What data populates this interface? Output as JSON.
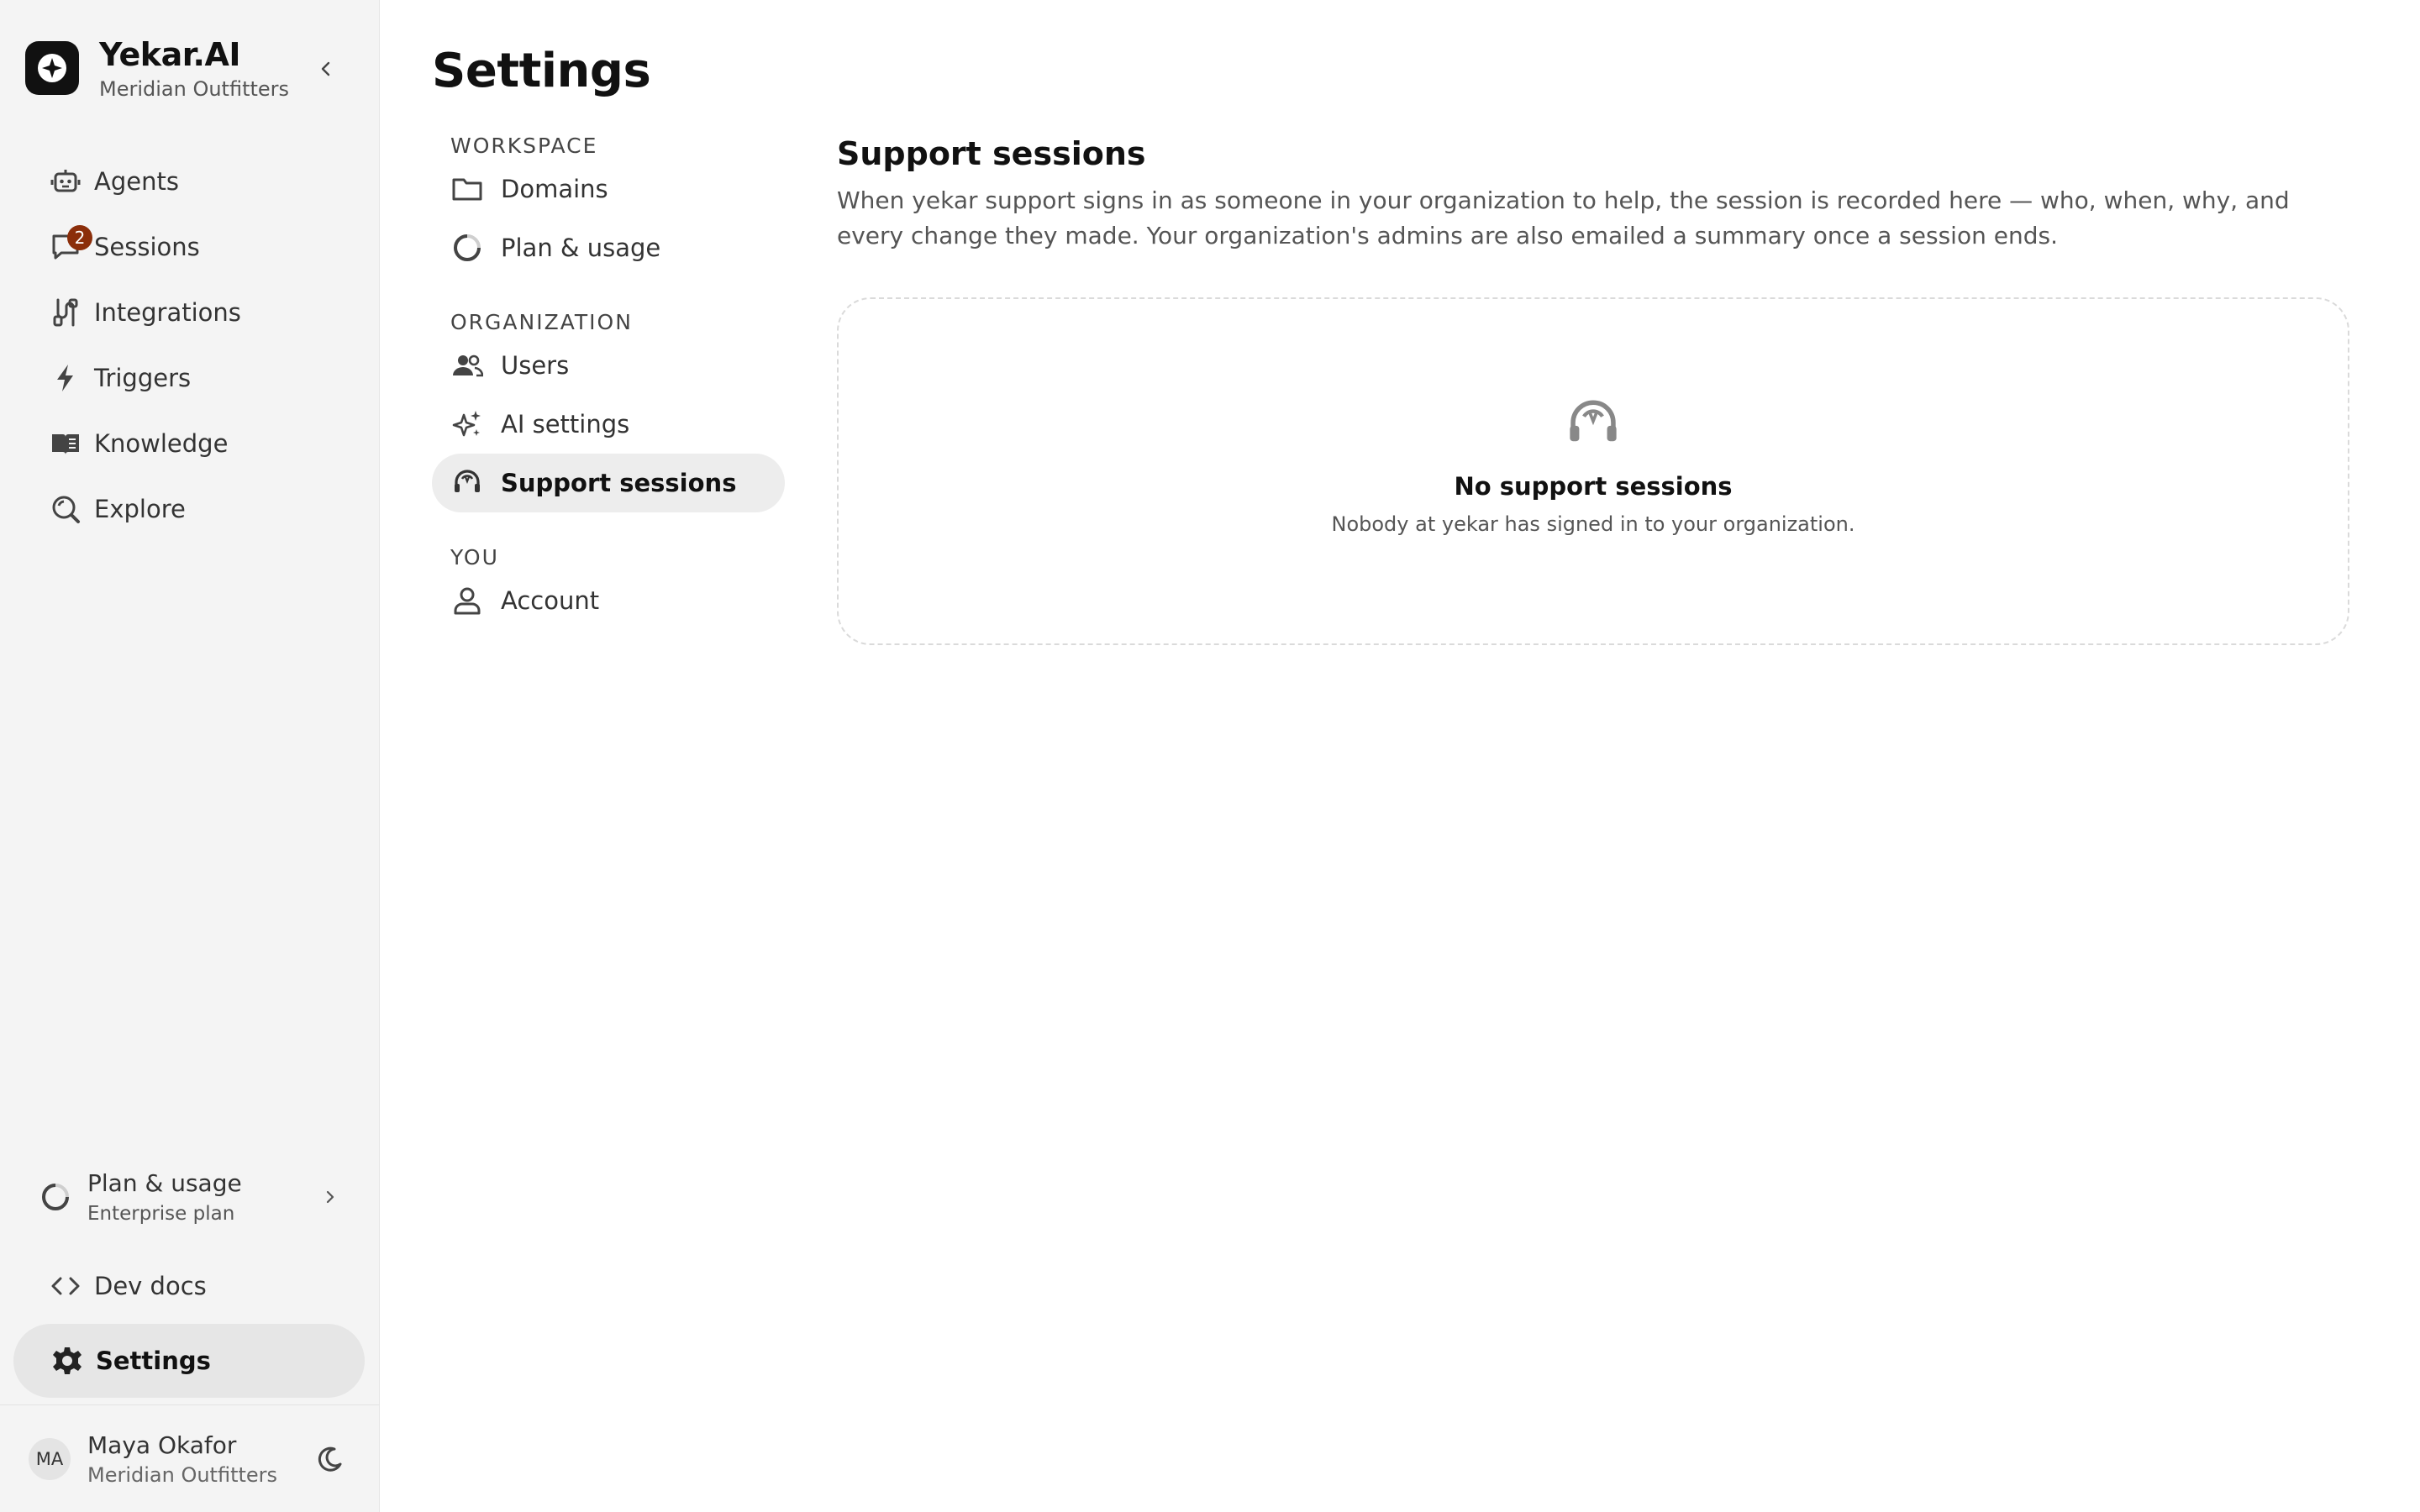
{
  "brand": {
    "name": "Yekar.AI",
    "org": "Meridian Outfitters"
  },
  "sidebar": {
    "items": [
      {
        "label": "Agents",
        "icon": "robot-icon"
      },
      {
        "label": "Sessions",
        "icon": "chat-icon",
        "badge": "2"
      },
      {
        "label": "Integrations",
        "icon": "plug-icon"
      },
      {
        "label": "Triggers",
        "icon": "bolt-icon"
      },
      {
        "label": "Knowledge",
        "icon": "book-icon"
      },
      {
        "label": "Explore",
        "icon": "explore-icon"
      }
    ],
    "plan": {
      "title": "Plan & usage",
      "subtitle": "Enterprise plan"
    },
    "dev_docs": "Dev docs",
    "settings": "Settings",
    "user": {
      "initials": "MA",
      "name": "Maya Okafor",
      "org": "Meridian Outfitters"
    }
  },
  "settings": {
    "title": "Settings",
    "sections": [
      {
        "label": "WORKSPACE",
        "items": [
          "Domains",
          "Plan & usage"
        ]
      },
      {
        "label": "ORGANIZATION",
        "items": [
          "Users",
          "AI settings",
          "Support sessions"
        ]
      },
      {
        "label": "YOU",
        "items": [
          "Account"
        ]
      }
    ],
    "active_item": "Support sessions"
  },
  "content": {
    "title": "Support sessions",
    "description": "When yekar support signs in as someone in your organization to help, the session is recorded here — who, when, why, and every change they made. Your organization's admins are also emailed a summary once a session ends.",
    "empty_title": "No support sessions",
    "empty_subtitle": "Nobody at yekar has signed in to your organization."
  },
  "colors": {
    "badge": "#8b2e0a",
    "sidebar_bg": "#f4f4f4",
    "active_bg": "#e6e6e6"
  }
}
